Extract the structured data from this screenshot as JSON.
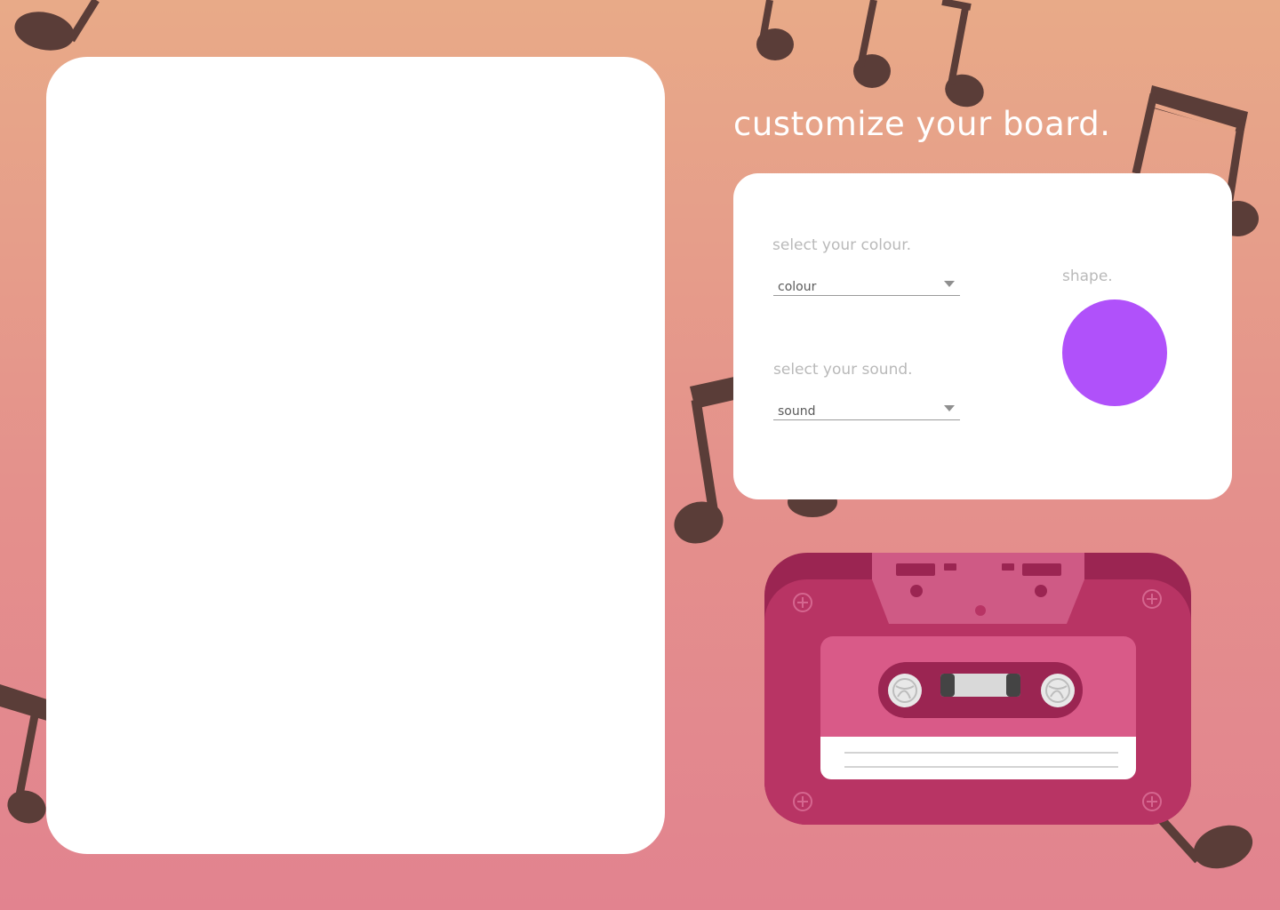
{
  "page": {
    "title": "customize your board."
  },
  "customize": {
    "colour_label": "select your colour.",
    "colour_value": "colour",
    "sound_label": "select your sound.",
    "sound_value": "sound",
    "shape_label": "shape.",
    "shape_color": "#b051fa"
  },
  "colors": {
    "background_top": "#e8aa88",
    "background_bottom": "#e2838f",
    "note": "#5a3d38",
    "cassette_body": "#b83464",
    "cassette_label": "#d95a88"
  },
  "icons": {
    "decor": "music-note-icon",
    "illustration": "cassette-tape-icon",
    "dropdown": "chevron-down-icon"
  }
}
